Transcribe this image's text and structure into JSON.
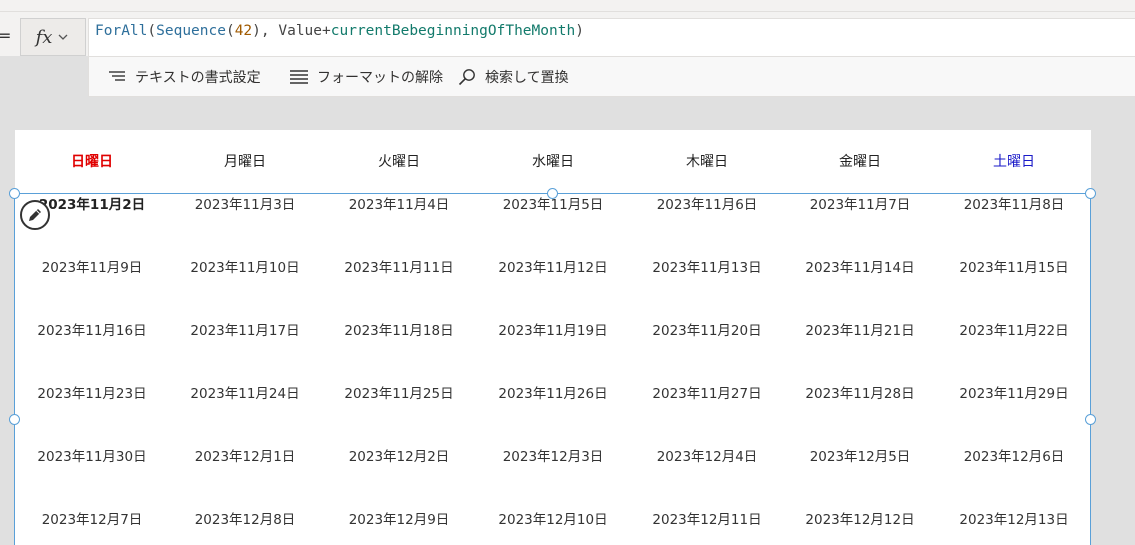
{
  "formula_bar": {
    "equals": "=",
    "fx_label": "fx",
    "formula_tokens": [
      {
        "text": "ForAll",
        "kind": "fn"
      },
      {
        "text": "(",
        "kind": "punc"
      },
      {
        "text": "Sequence",
        "kind": "fn"
      },
      {
        "text": "(",
        "kind": "punc"
      },
      {
        "text": "42",
        "kind": "num"
      },
      {
        "text": "), Value+",
        "kind": "punc"
      },
      {
        "text": "currentBebeginningOfTheMonth",
        "kind": "var"
      },
      {
        "text": ")",
        "kind": "punc"
      }
    ]
  },
  "toolbar": {
    "format_text": "テキストの書式設定",
    "remove_format": "フォーマットの解除",
    "find_replace": "検索して置換"
  },
  "calendar": {
    "weekdays": [
      "日曜日",
      "月曜日",
      "火曜日",
      "水曜日",
      "木曜日",
      "金曜日",
      "土曜日"
    ],
    "rows": [
      [
        "2023年11月2日",
        "2023年11月3日",
        "2023年11月4日",
        "2023年11月5日",
        "2023年11月6日",
        "2023年11月7日",
        "2023年11月8日"
      ],
      [
        "2023年11月9日",
        "2023年11月10日",
        "2023年11月11日",
        "2023年11月12日",
        "2023年11月13日",
        "2023年11月14日",
        "2023年11月15日"
      ],
      [
        "2023年11月16日",
        "2023年11月17日",
        "2023年11月18日",
        "2023年11月19日",
        "2023年11月20日",
        "2023年11月21日",
        "2023年11月22日"
      ],
      [
        "2023年11月23日",
        "2023年11月24日",
        "2023年11月25日",
        "2023年11月26日",
        "2023年11月27日",
        "2023年11月28日",
        "2023年11月29日"
      ],
      [
        "2023年11月30日",
        "2023年12月1日",
        "2023年12月2日",
        "2023年12月3日",
        "2023年12月4日",
        "2023年12月5日",
        "2023年12月6日"
      ],
      [
        "2023年12月7日",
        "2023年12月8日",
        "2023年12月9日",
        "2023年12月10日",
        "2023年12月11日",
        "2023年12月12日",
        "2023年12月13日"
      ]
    ]
  },
  "colors": {
    "sunday": "#e00000",
    "saturday": "#1a1ac8",
    "selection": "#5aa0d8"
  }
}
